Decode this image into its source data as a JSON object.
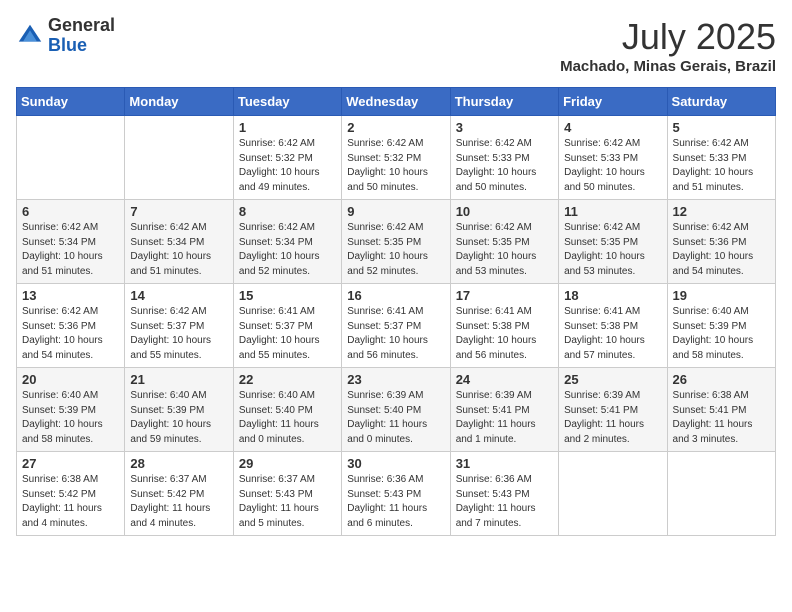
{
  "logo": {
    "general": "General",
    "blue": "Blue"
  },
  "title": {
    "month": "July 2025",
    "location": "Machado, Minas Gerais, Brazil"
  },
  "weekdays": [
    "Sunday",
    "Monday",
    "Tuesday",
    "Wednesday",
    "Thursday",
    "Friday",
    "Saturday"
  ],
  "weeks": [
    [
      {
        "day": "",
        "info": ""
      },
      {
        "day": "",
        "info": ""
      },
      {
        "day": "1",
        "info": "Sunrise: 6:42 AM\nSunset: 5:32 PM\nDaylight: 10 hours\nand 49 minutes."
      },
      {
        "day": "2",
        "info": "Sunrise: 6:42 AM\nSunset: 5:32 PM\nDaylight: 10 hours\nand 50 minutes."
      },
      {
        "day": "3",
        "info": "Sunrise: 6:42 AM\nSunset: 5:33 PM\nDaylight: 10 hours\nand 50 minutes."
      },
      {
        "day": "4",
        "info": "Sunrise: 6:42 AM\nSunset: 5:33 PM\nDaylight: 10 hours\nand 50 minutes."
      },
      {
        "day": "5",
        "info": "Sunrise: 6:42 AM\nSunset: 5:33 PM\nDaylight: 10 hours\nand 51 minutes."
      }
    ],
    [
      {
        "day": "6",
        "info": "Sunrise: 6:42 AM\nSunset: 5:34 PM\nDaylight: 10 hours\nand 51 minutes."
      },
      {
        "day": "7",
        "info": "Sunrise: 6:42 AM\nSunset: 5:34 PM\nDaylight: 10 hours\nand 51 minutes."
      },
      {
        "day": "8",
        "info": "Sunrise: 6:42 AM\nSunset: 5:34 PM\nDaylight: 10 hours\nand 52 minutes."
      },
      {
        "day": "9",
        "info": "Sunrise: 6:42 AM\nSunset: 5:35 PM\nDaylight: 10 hours\nand 52 minutes."
      },
      {
        "day": "10",
        "info": "Sunrise: 6:42 AM\nSunset: 5:35 PM\nDaylight: 10 hours\nand 53 minutes."
      },
      {
        "day": "11",
        "info": "Sunrise: 6:42 AM\nSunset: 5:35 PM\nDaylight: 10 hours\nand 53 minutes."
      },
      {
        "day": "12",
        "info": "Sunrise: 6:42 AM\nSunset: 5:36 PM\nDaylight: 10 hours\nand 54 minutes."
      }
    ],
    [
      {
        "day": "13",
        "info": "Sunrise: 6:42 AM\nSunset: 5:36 PM\nDaylight: 10 hours\nand 54 minutes."
      },
      {
        "day": "14",
        "info": "Sunrise: 6:42 AM\nSunset: 5:37 PM\nDaylight: 10 hours\nand 55 minutes."
      },
      {
        "day": "15",
        "info": "Sunrise: 6:41 AM\nSunset: 5:37 PM\nDaylight: 10 hours\nand 55 minutes."
      },
      {
        "day": "16",
        "info": "Sunrise: 6:41 AM\nSunset: 5:37 PM\nDaylight: 10 hours\nand 56 minutes."
      },
      {
        "day": "17",
        "info": "Sunrise: 6:41 AM\nSunset: 5:38 PM\nDaylight: 10 hours\nand 56 minutes."
      },
      {
        "day": "18",
        "info": "Sunrise: 6:41 AM\nSunset: 5:38 PM\nDaylight: 10 hours\nand 57 minutes."
      },
      {
        "day": "19",
        "info": "Sunrise: 6:40 AM\nSunset: 5:39 PM\nDaylight: 10 hours\nand 58 minutes."
      }
    ],
    [
      {
        "day": "20",
        "info": "Sunrise: 6:40 AM\nSunset: 5:39 PM\nDaylight: 10 hours\nand 58 minutes."
      },
      {
        "day": "21",
        "info": "Sunrise: 6:40 AM\nSunset: 5:39 PM\nDaylight: 10 hours\nand 59 minutes."
      },
      {
        "day": "22",
        "info": "Sunrise: 6:40 AM\nSunset: 5:40 PM\nDaylight: 11 hours\nand 0 minutes."
      },
      {
        "day": "23",
        "info": "Sunrise: 6:39 AM\nSunset: 5:40 PM\nDaylight: 11 hours\nand 0 minutes."
      },
      {
        "day": "24",
        "info": "Sunrise: 6:39 AM\nSunset: 5:41 PM\nDaylight: 11 hours\nand 1 minute."
      },
      {
        "day": "25",
        "info": "Sunrise: 6:39 AM\nSunset: 5:41 PM\nDaylight: 11 hours\nand 2 minutes."
      },
      {
        "day": "26",
        "info": "Sunrise: 6:38 AM\nSunset: 5:41 PM\nDaylight: 11 hours\nand 3 minutes."
      }
    ],
    [
      {
        "day": "27",
        "info": "Sunrise: 6:38 AM\nSunset: 5:42 PM\nDaylight: 11 hours\nand 4 minutes."
      },
      {
        "day": "28",
        "info": "Sunrise: 6:37 AM\nSunset: 5:42 PM\nDaylight: 11 hours\nand 4 minutes."
      },
      {
        "day": "29",
        "info": "Sunrise: 6:37 AM\nSunset: 5:43 PM\nDaylight: 11 hours\nand 5 minutes."
      },
      {
        "day": "30",
        "info": "Sunrise: 6:36 AM\nSunset: 5:43 PM\nDaylight: 11 hours\nand 6 minutes."
      },
      {
        "day": "31",
        "info": "Sunrise: 6:36 AM\nSunset: 5:43 PM\nDaylight: 11 hours\nand 7 minutes."
      },
      {
        "day": "",
        "info": ""
      },
      {
        "day": "",
        "info": ""
      }
    ]
  ]
}
